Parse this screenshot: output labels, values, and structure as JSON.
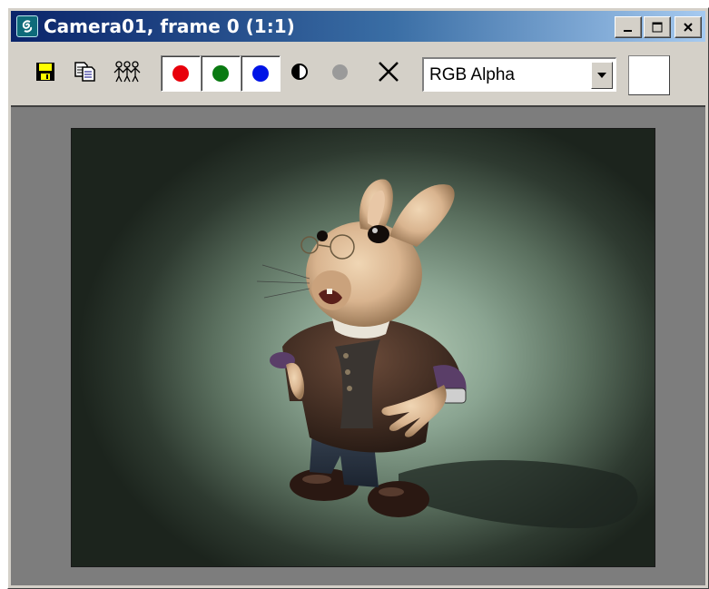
{
  "window": {
    "title": "Camera01, frame 0 (1:1)",
    "caption_buttons": {
      "minimize": "minimize-button",
      "maximize": "maximize-button",
      "close": "close-button"
    }
  },
  "toolbar": {
    "tools": [
      {
        "name": "save-image",
        "icon": "floppy-disk-icon"
      },
      {
        "name": "copy-image",
        "icon": "copy-icon"
      },
      {
        "name": "clone-window",
        "icon": "clone-people-icon"
      }
    ],
    "channels": [
      {
        "name": "red",
        "color": "#e8000b",
        "enabled": true
      },
      {
        "name": "green",
        "color": "#0a7a12",
        "enabled": true
      },
      {
        "name": "blue",
        "color": "#0014e6",
        "enabled": true
      },
      {
        "name": "monochrome",
        "icon": "half-circle-icon"
      },
      {
        "name": "alpha",
        "color": "#9a9a9a",
        "icon": "gray-dot-icon"
      },
      {
        "name": "clear",
        "icon": "x-icon"
      }
    ],
    "display_channel": {
      "selected": "RGB Alpha"
    },
    "background_swatch_color": "#ffffff"
  },
  "viewport": {
    "background_color": "#7d7d7d",
    "render_description_colors": {
      "center": "#b3cbb6",
      "edge": "#1c241d"
    }
  }
}
